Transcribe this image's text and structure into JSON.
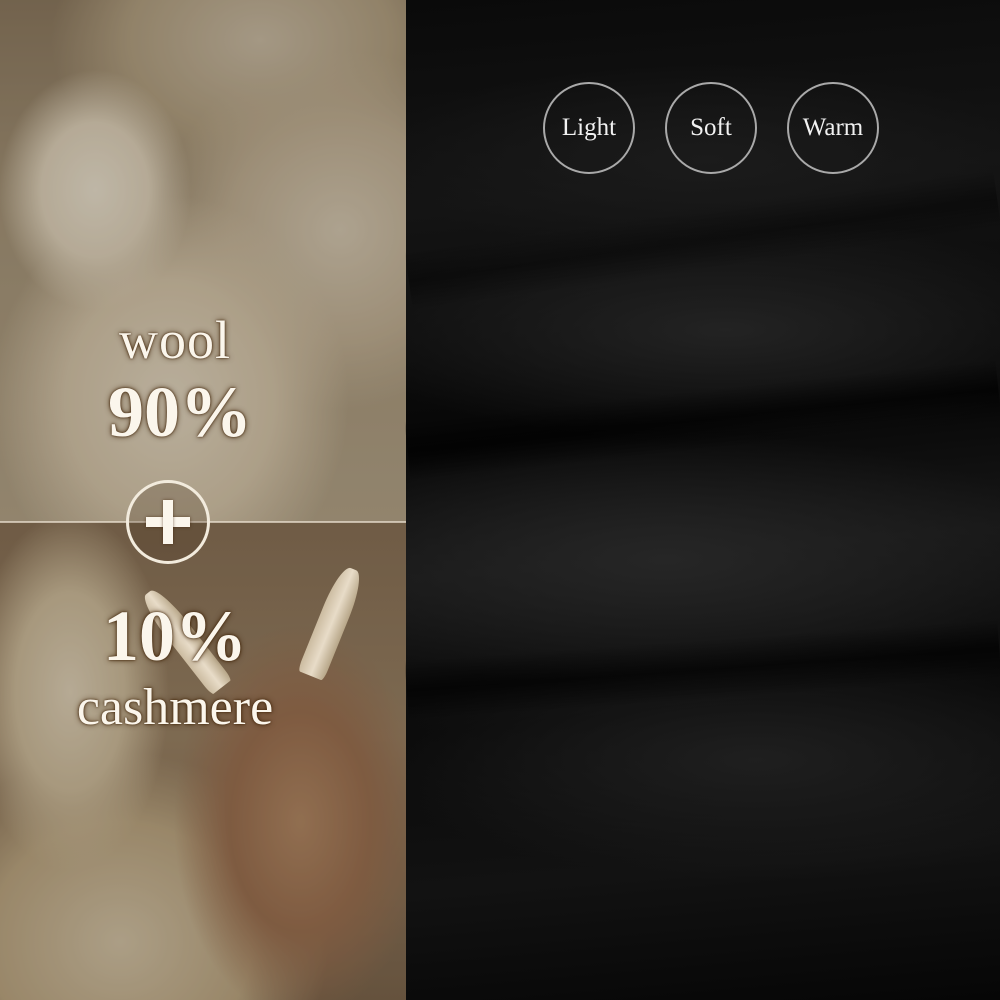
{
  "composition": {
    "wool_label": "wool",
    "wool_percent": "90%",
    "cashmere_percent": "10%",
    "cashmere_label": "cashmere",
    "plus_icon": "plus-icon"
  },
  "features": [
    {
      "label": "Light"
    },
    {
      "label": "Soft"
    },
    {
      "label": "Warm"
    }
  ],
  "colors": {
    "text": "#fbf6ec",
    "badge_border": "#a9a9a9",
    "fabric": "#111111"
  }
}
